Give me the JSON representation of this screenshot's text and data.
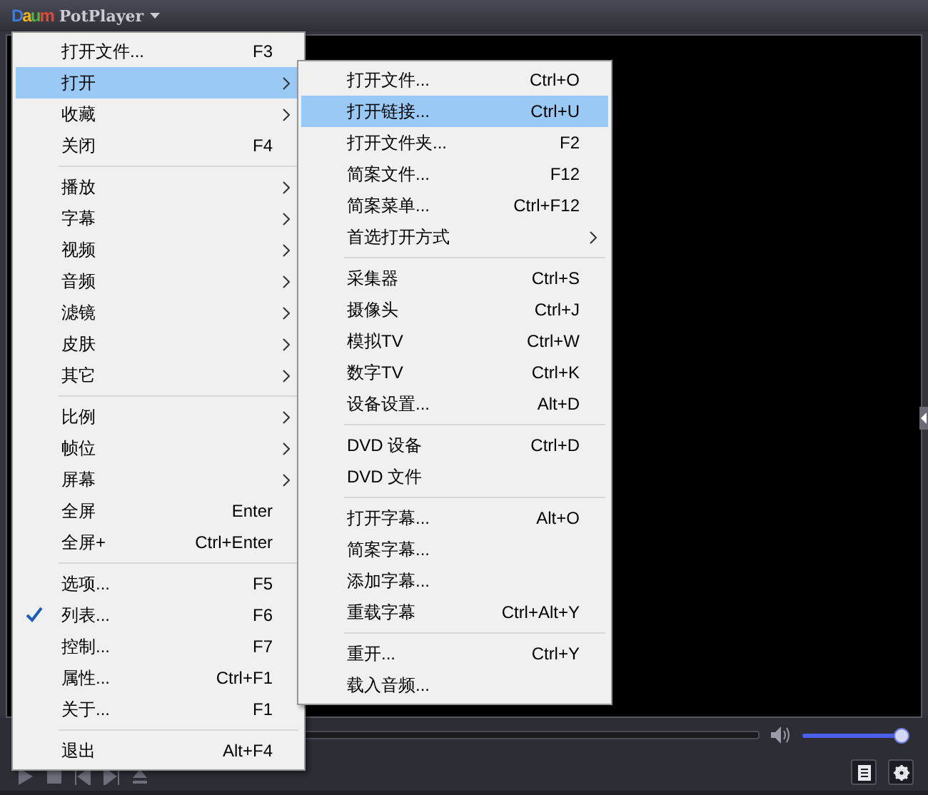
{
  "window": {
    "logo": "Daum",
    "title": "PotPlayer"
  },
  "main_menu": [
    {
      "kind": "item",
      "label": "打开文件...",
      "shortcut": "F3",
      "selected": false,
      "checked": false
    },
    {
      "kind": "submenu",
      "label": "打开",
      "selected": true,
      "checked": false
    },
    {
      "kind": "submenu",
      "label": "收藏",
      "selected": false,
      "checked": false
    },
    {
      "kind": "item",
      "label": "关闭",
      "shortcut": "F4",
      "selected": false,
      "checked": false
    },
    {
      "kind": "separator"
    },
    {
      "kind": "submenu",
      "label": "播放",
      "selected": false,
      "checked": false
    },
    {
      "kind": "submenu",
      "label": "字幕",
      "selected": false,
      "checked": false
    },
    {
      "kind": "submenu",
      "label": "视频",
      "selected": false,
      "checked": false
    },
    {
      "kind": "submenu",
      "label": "音频",
      "selected": false,
      "checked": false
    },
    {
      "kind": "submenu",
      "label": "滤镜",
      "selected": false,
      "checked": false
    },
    {
      "kind": "submenu",
      "label": "皮肤",
      "selected": false,
      "checked": false
    },
    {
      "kind": "submenu",
      "label": "其它",
      "selected": false,
      "checked": false
    },
    {
      "kind": "separator"
    },
    {
      "kind": "submenu",
      "label": "比例",
      "selected": false,
      "checked": false
    },
    {
      "kind": "submenu",
      "label": "帧位",
      "selected": false,
      "checked": false
    },
    {
      "kind": "submenu",
      "label": "屏幕",
      "selected": false,
      "checked": false
    },
    {
      "kind": "item",
      "label": "全屏",
      "shortcut": "Enter",
      "selected": false,
      "checked": false
    },
    {
      "kind": "item",
      "label": "全屏+",
      "shortcut": "Ctrl+Enter",
      "selected": false,
      "checked": false
    },
    {
      "kind": "separator"
    },
    {
      "kind": "item",
      "label": "选项...",
      "shortcut": "F5",
      "selected": false,
      "checked": false
    },
    {
      "kind": "item",
      "label": "列表...",
      "shortcut": "F6",
      "selected": false,
      "checked": true
    },
    {
      "kind": "item",
      "label": "控制...",
      "shortcut": "F7",
      "selected": false,
      "checked": false
    },
    {
      "kind": "item",
      "label": "属性...",
      "shortcut": "Ctrl+F1",
      "selected": false,
      "checked": false
    },
    {
      "kind": "item",
      "label": "关于...",
      "shortcut": "F1",
      "selected": false,
      "checked": false
    },
    {
      "kind": "separator"
    },
    {
      "kind": "item",
      "label": "退出",
      "shortcut": "Alt+F4",
      "selected": false,
      "checked": false
    }
  ],
  "open_submenu": [
    {
      "kind": "item",
      "label": "打开文件...",
      "shortcut": "Ctrl+O",
      "selected": false
    },
    {
      "kind": "item",
      "label": "打开链接...",
      "shortcut": "Ctrl+U",
      "selected": true
    },
    {
      "kind": "item",
      "label": "打开文件夹...",
      "shortcut": "F2",
      "selected": false
    },
    {
      "kind": "item",
      "label": "简案文件...",
      "shortcut": "F12",
      "selected": false
    },
    {
      "kind": "item",
      "label": "简案菜单...",
      "shortcut": "Ctrl+F12",
      "selected": false
    },
    {
      "kind": "submenu",
      "label": "首选打开方式",
      "selected": false
    },
    {
      "kind": "separator"
    },
    {
      "kind": "item",
      "label": "采集器",
      "shortcut": "Ctrl+S",
      "selected": false
    },
    {
      "kind": "item",
      "label": "摄像头",
      "shortcut": "Ctrl+J",
      "selected": false
    },
    {
      "kind": "item",
      "label": "模拟TV",
      "shortcut": "Ctrl+W",
      "selected": false
    },
    {
      "kind": "item",
      "label": "数字TV",
      "shortcut": "Ctrl+K",
      "selected": false
    },
    {
      "kind": "item",
      "label": "设备设置...",
      "shortcut": "Alt+D",
      "selected": false
    },
    {
      "kind": "separator"
    },
    {
      "kind": "item",
      "label": "DVD 设备",
      "shortcut": "Ctrl+D",
      "selected": false
    },
    {
      "kind": "item",
      "label": "DVD 文件",
      "selected": false
    },
    {
      "kind": "separator"
    },
    {
      "kind": "item",
      "label": "打开字幕...",
      "shortcut": "Alt+O",
      "selected": false
    },
    {
      "kind": "item",
      "label": "简案字幕...",
      "selected": false
    },
    {
      "kind": "item",
      "label": "添加字幕...",
      "selected": false
    },
    {
      "kind": "item",
      "label": "重载字幕",
      "shortcut": "Ctrl+Alt+Y",
      "selected": false
    },
    {
      "kind": "separator"
    },
    {
      "kind": "item",
      "label": "重开...",
      "shortcut": "Ctrl+Y",
      "selected": false
    },
    {
      "kind": "item",
      "label": "载入音频...",
      "selected": false
    }
  ],
  "volume": {
    "level": 0.93
  }
}
